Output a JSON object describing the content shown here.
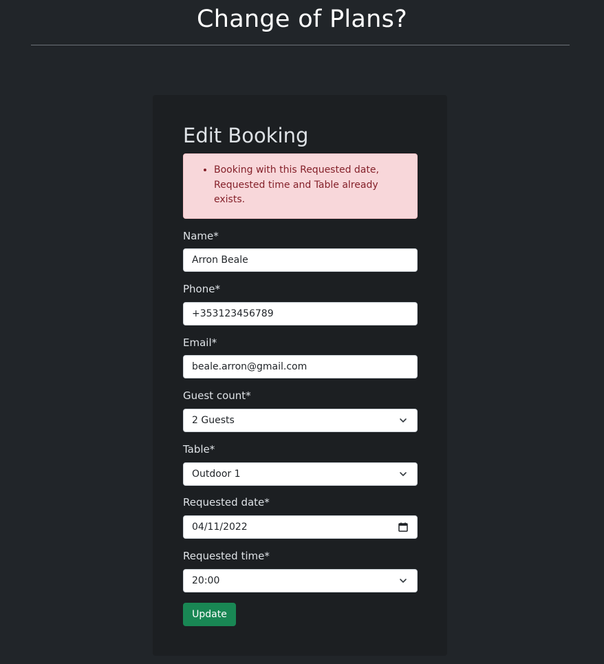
{
  "page": {
    "title": "Change of Plans?"
  },
  "form": {
    "heading": "Edit Booking",
    "errors": [
      "Booking with this Requested date, Requested time and Table already exists."
    ],
    "fields": {
      "name": {
        "label": "Name*",
        "value": "Arron Beale"
      },
      "phone": {
        "label": "Phone*",
        "value": "+353123456789"
      },
      "email": {
        "label": "Email*",
        "value": "beale.arron@gmail.com"
      },
      "guest_count": {
        "label": "Guest count*",
        "value": "2 Guests"
      },
      "table": {
        "label": "Table*",
        "value": "Outdoor 1"
      },
      "requested_date": {
        "label": "Requested date*",
        "value": "04/11/2022"
      },
      "requested_time": {
        "label": "Requested time*",
        "value": "20:00"
      }
    },
    "submit_label": "Update"
  },
  "colors": {
    "page_bg": "#212529",
    "card_bg": "#1c1f22",
    "alert_bg": "#f8d7da",
    "alert_text": "#842029",
    "button_bg": "#198754"
  }
}
